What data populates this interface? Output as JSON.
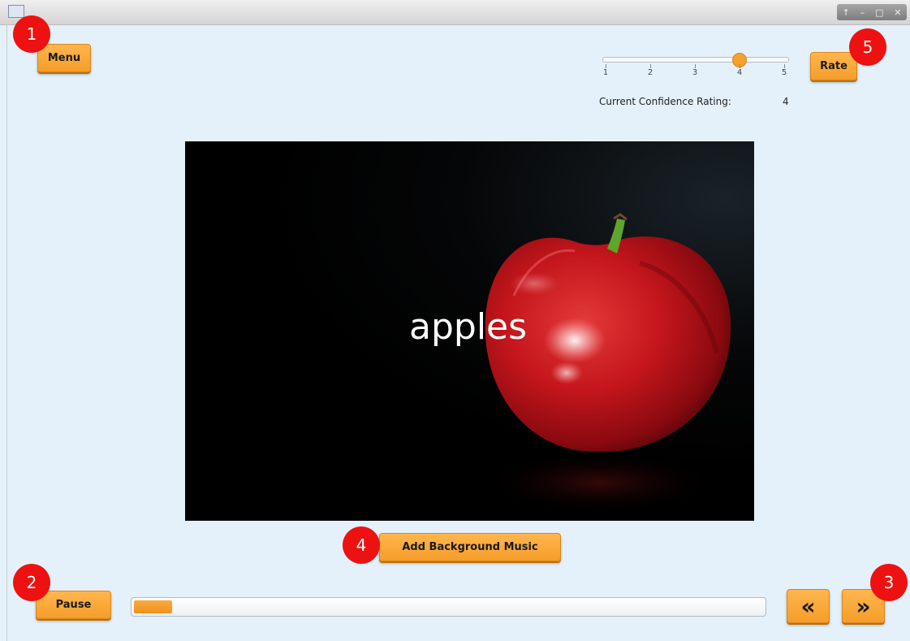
{
  "window": {
    "controls": [
      "↑",
      "–",
      "□",
      "✕"
    ]
  },
  "menu_label": "Menu",
  "rate_label": "Rate",
  "pause_label": "Pause",
  "music_label": "Add Background Music",
  "prev_label": "«",
  "next_label": "»",
  "badges": [
    "1",
    "2",
    "3",
    "4",
    "5"
  ],
  "rating": {
    "ticks": [
      "1",
      "2",
      "3",
      "4",
      "5"
    ],
    "value": 4,
    "label": "Current Confidence Rating:",
    "display_value": "4"
  },
  "flashcard": {
    "word": "apples"
  },
  "progress_fraction": 0.06,
  "colors": {
    "button": "#f59d2a",
    "badge": "#ee1111",
    "background": "#e4f1fb"
  }
}
